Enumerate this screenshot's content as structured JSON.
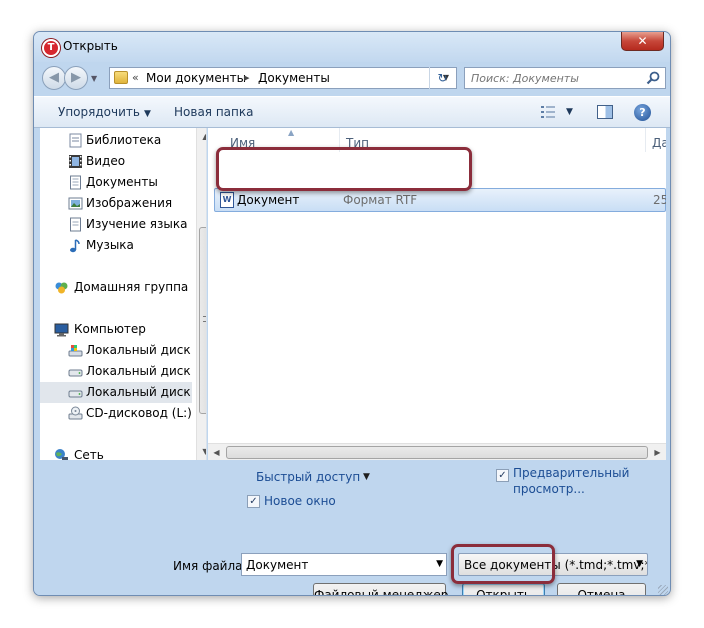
{
  "window": {
    "title": "Открыть",
    "close_label": "✕"
  },
  "address": {
    "breadcrumbs": [
      "Мои документы",
      "Документы"
    ],
    "search_placeholder": "Поиск: Документы"
  },
  "toolbar": {
    "organize_label": "Упорядочить",
    "new_folder_label": "Новая папка"
  },
  "sidebar": {
    "items": [
      {
        "label": "Библиотека",
        "icon": "library-icon"
      },
      {
        "label": "Видео",
        "icon": "video-icon"
      },
      {
        "label": "Документы",
        "icon": "documents-icon"
      },
      {
        "label": "Изображения",
        "icon": "pictures-icon"
      },
      {
        "label": "Изучение языка",
        "icon": "language-icon"
      },
      {
        "label": "Музыка",
        "icon": "music-icon"
      },
      {
        "label": "Домашняя группа",
        "icon": "homegroup-icon"
      },
      {
        "label": "Компьютер",
        "icon": "computer-icon"
      },
      {
        "label": "Локальный диск (",
        "icon": "system-drive-icon"
      },
      {
        "label": "Локальный диск (",
        "icon": "drive-icon"
      },
      {
        "label": "Локальный диск (",
        "icon": "drive-icon"
      },
      {
        "label": "CD-дисковод (L:)",
        "icon": "cd-drive-icon"
      },
      {
        "label": "Сеть",
        "icon": "network-icon"
      }
    ],
    "selected_index": 10
  },
  "file_list": {
    "columns": [
      "Имя",
      "Тип",
      "Да"
    ],
    "rows": [
      {
        "name": "Документ",
        "type": "Формат RTF",
        "date": "25"
      }
    ]
  },
  "options": {
    "quick_access_label": "Быстрый доступ",
    "new_window_label": "Новое окно",
    "new_window_checked": true,
    "preview_label_line1": "Предварительный",
    "preview_label_line2": "просмотр...",
    "preview_checked": true
  },
  "filename": {
    "label": "Имя файла:",
    "value": "Документ"
  },
  "filter": {
    "selected": "Все документы (*.tmd;*.tmv;*."
  },
  "buttons": {
    "file_manager": "Файловый менеджер...",
    "open": "Открыть",
    "cancel": "Отмена"
  },
  "colors": {
    "window_frame": "#bfd6ee",
    "highlight_ring": "#8b2d3b",
    "link": "#1c4d94"
  }
}
